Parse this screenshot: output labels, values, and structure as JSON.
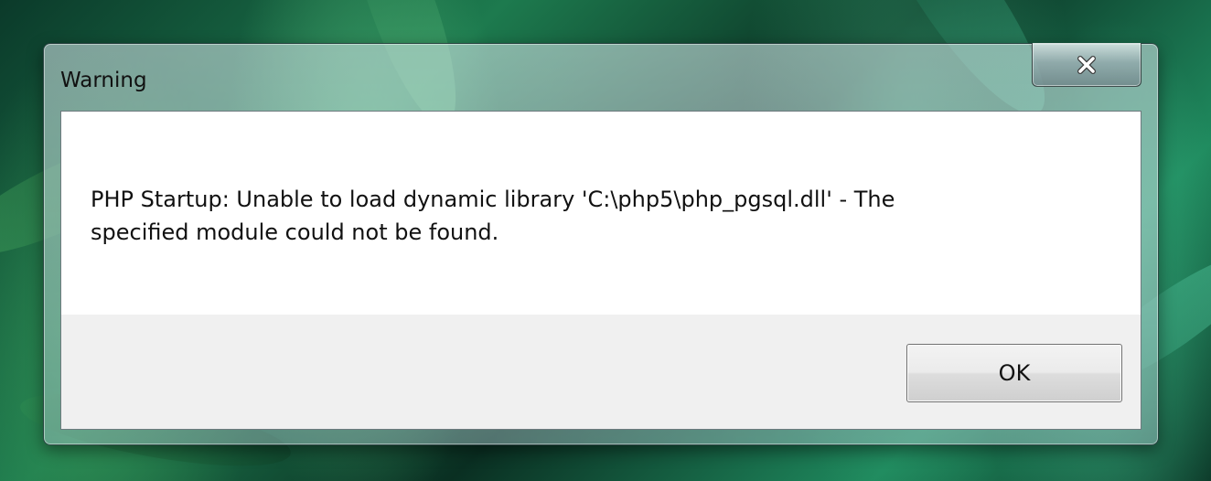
{
  "window": {
    "title": "Warning",
    "close_icon": "close-x-icon"
  },
  "message": {
    "text": "PHP Startup: Unable to load dynamic library 'C:\\php5\\php_pgsql.dll' - The\nspecified module could not be found."
  },
  "buttons": {
    "ok_label": "OK"
  },
  "colors": {
    "close_glyph": "#ffffff",
    "dialog_background": "#ffffff",
    "button_area": "#f0f0f0"
  }
}
